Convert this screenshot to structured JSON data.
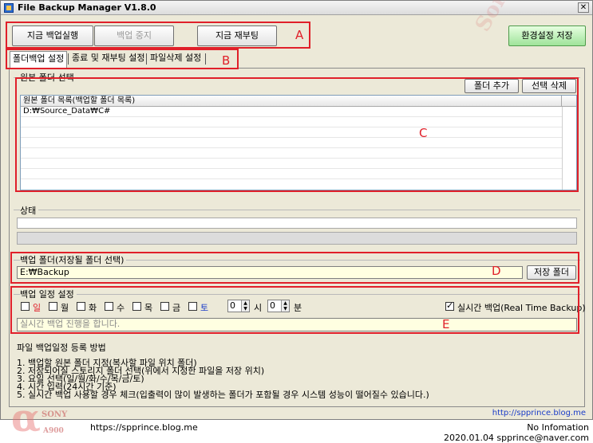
{
  "window": {
    "title": "File Backup Manager V1.8.0",
    "close_glyph": "✕"
  },
  "toolbar": {
    "run_backup_now": "지금 백업실행",
    "stop_backup": "백업 중지",
    "reboot_now": "지금 재부팅",
    "save_settings": "환경설정 저장"
  },
  "annotations": {
    "a": "A",
    "b": "B",
    "c": "C",
    "d": "D",
    "e": "E"
  },
  "tabs": [
    {
      "label": "폴더백업 설정"
    },
    {
      "label": "종료 및 재부팅 설정"
    },
    {
      "label": "파일삭제 설정"
    }
  ],
  "source_group": {
    "title": "원본 폴더 선택",
    "add_folder": "폴더 추가",
    "delete_selected": "선택 삭제",
    "list_header": "원본 폴더 목록(백업할 폴더 목록)",
    "rows": [
      "D:₩Source_Data₩C#"
    ]
  },
  "status_group": {
    "title": "상태"
  },
  "backup_folder_group": {
    "title": "백업 폴더(저장될 폴더 선택)",
    "path": "E:₩Backup",
    "save_folder_button": "저장 폴더"
  },
  "schedule_group": {
    "title": "백업 일정 설정",
    "days": [
      {
        "label": "일",
        "color": "#e0202a",
        "checked": false
      },
      {
        "label": "월",
        "color": "#000000",
        "checked": false
      },
      {
        "label": "화",
        "color": "#000000",
        "checked": false
      },
      {
        "label": "수",
        "color": "#000000",
        "checked": false
      },
      {
        "label": "목",
        "color": "#000000",
        "checked": false
      },
      {
        "label": "금",
        "color": "#000000",
        "checked": false
      },
      {
        "label": "토",
        "color": "#1a3cc8",
        "checked": false
      }
    ],
    "hour_value": "0",
    "hour_unit": "시",
    "minute_value": "0",
    "minute_unit": "분",
    "realtime_label": "실시간 백업(Real Time Backup)",
    "realtime_checked": true,
    "status_message": "실시간 백업 진행을 합니다."
  },
  "guide": {
    "heading": "파일 백업일정 등록 방법",
    "steps": [
      "1. 백업할 원본 폴더 지정(복사할 파일 위치 폴더)",
      "2. 저장되어질 스토리지 폴더 선택(위에서 지정한 파일을 저장 위치)",
      "3. 요일 선택(일/월/화/수/목/금/토)",
      "4. 시간 입력(24시간 기준)",
      "5. 실시간 백업 사용할 경우 체크(입출력이 많이 발생하는 폴더가 포함될 경우 시스템 성능이 떨어질수 있습니다.)"
    ]
  },
  "bottom_link": "http://spprince.blog.me",
  "footer": {
    "blog": "https://spprince.blog.me",
    "info": "No Infomation",
    "date_email": "2020.01.04  spprince@naver.com"
  },
  "watermark": {
    "brand": "SONY",
    "model": "A900",
    "alpha": "α",
    "diag": "Sony St"
  },
  "colors": {
    "annotation_red": "#e0202a",
    "sunday": "#e0202a",
    "saturday": "#1a3cc8",
    "link": "#1a3cc8",
    "input_bg": "#ffffe1"
  }
}
